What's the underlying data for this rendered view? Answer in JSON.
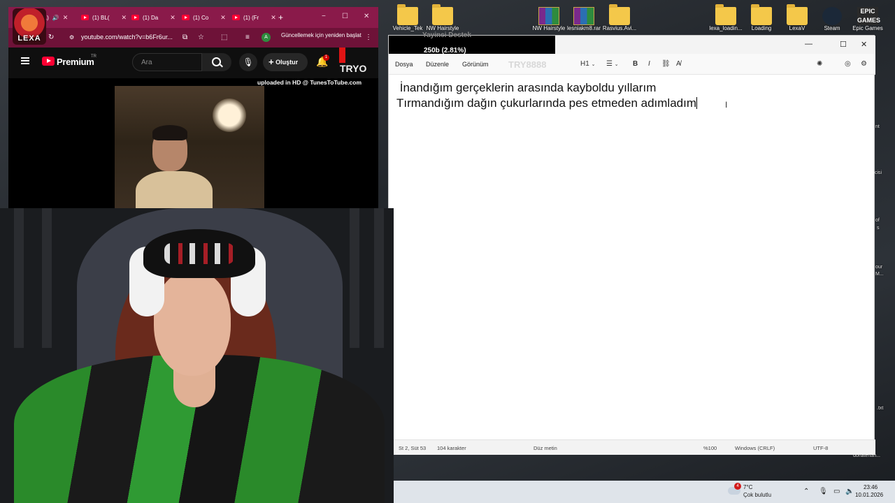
{
  "desktop": {
    "icons": [
      {
        "label": "Vehicle_Tek",
        "icon": "folder-icon"
      },
      {
        "label": "NW Hairstyle",
        "icon": "folder-icon"
      },
      {
        "label": "NW Hairstyle",
        "icon": "winrar-icon"
      },
      {
        "label": "lesniakm8.rar",
        "icon": "winrar-icon"
      },
      {
        "label": "Rasvius.Avi...",
        "icon": "folder-icon"
      },
      {
        "label": "lexa_loadin...",
        "icon": "folder-icon"
      },
      {
        "label": "Loading",
        "icon": "folder-icon"
      },
      {
        "label": "LexaV",
        "icon": "folder-icon"
      },
      {
        "label": "Steam",
        "icon": "steam-icon"
      },
      {
        "label": "Epic Games",
        "icon": "epic-games-icon"
      }
    ],
    "epic_logo_text": "EPIC\nGAMES",
    "side_snippets": [
      "nt",
      "cisi",
      "of",
      "s",
      "our",
      "M...",
      ".txt",
      "donatehan..."
    ],
    "ghost_text": "Yayinci Destek"
  },
  "browser": {
    "profile_label": "LEXA",
    "tabs": [
      {
        "label": "(1)",
        "active": true
      },
      {
        "label": "(1) BL("
      },
      {
        "label": "(1) Da"
      },
      {
        "label": "(1) Co"
      },
      {
        "label": "(1) (Fr"
      }
    ],
    "new_tab": "+",
    "window_controls": {
      "minimize": "−",
      "maximize": "☐",
      "close": "✕"
    },
    "url": "youtube.com/watch?v=b6Fr6ur...",
    "update_button": "Güncellemek için yeniden başlat",
    "youtube": {
      "logo_text": "Premium",
      "region": "TR",
      "search_placeholder": "Ara",
      "create_label": "Oluştur",
      "notification_count": "1",
      "overlay_text": "TRYO",
      "uploaded_text": "uploaded in HD @ TunesToTube.com"
    }
  },
  "notepad": {
    "tab_overlay": "250b (2.81%)",
    "tab_ghost": "Yayinci Destek",
    "window_controls": {
      "minimize": "—",
      "maximize": "☐",
      "close": "✕"
    },
    "menu": [
      "Dosya",
      "Düzenle",
      "Görünüm"
    ],
    "ghost_watermark": "TRY8888",
    "toolbar": {
      "heading": "H1",
      "bold": "B",
      "italic": "I"
    },
    "lines": [
      " İnandığım gerçeklerin arasında kayboldu yıllarım",
      "Tırmandığım dağın çukurlarında pes etmeden adımladım"
    ],
    "status": {
      "position": "St 2, Süt 53",
      "chars": "104 karakter",
      "format": "Düz metin",
      "zoom": "%100",
      "line_ending": "Windows (CRLF)",
      "encoding": "UTF-8"
    }
  },
  "taskbar": {
    "weather_badge": "4",
    "temperature": "7°C",
    "weather_desc": "Çok bulutlu",
    "time": "23:46",
    "date": "10.01.2026"
  }
}
